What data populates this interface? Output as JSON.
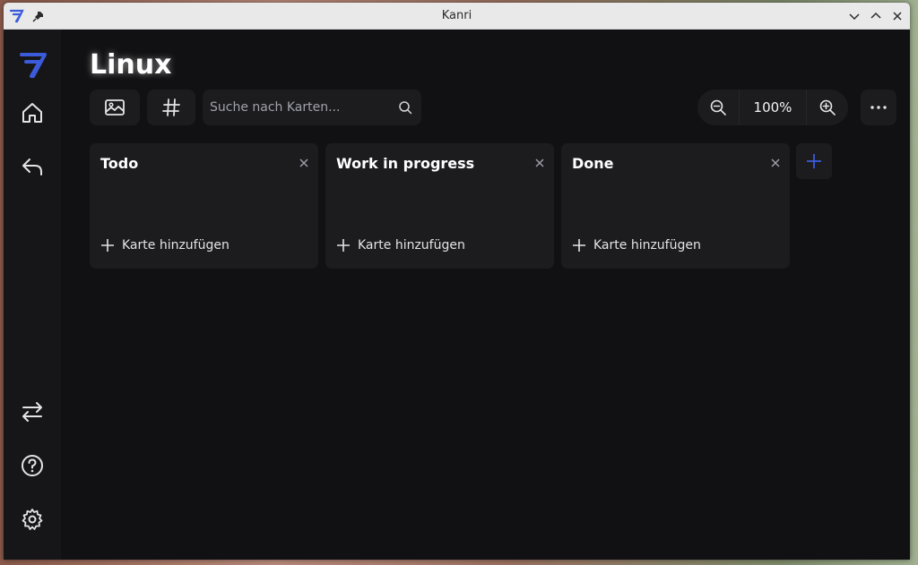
{
  "window": {
    "title": "Kanri"
  },
  "board": {
    "title": "Linux"
  },
  "toolbar": {
    "search_placeholder": "Suche nach Karten...",
    "zoom_value": "100%"
  },
  "columns": [
    {
      "title": "Todo",
      "add_label": "Karte hinzufügen"
    },
    {
      "title": "Work in progress",
      "add_label": "Karte hinzufügen"
    },
    {
      "title": "Done",
      "add_label": "Karte hinzufügen"
    }
  ],
  "sidebar": {
    "icons": [
      "logo-icon",
      "home-icon",
      "back-arrow-icon",
      "transfer-icon",
      "help-icon",
      "settings-icon"
    ]
  },
  "colors": {
    "accent": "#3b5bdb",
    "background": "#111113",
    "surface": "#1c1c1f"
  }
}
